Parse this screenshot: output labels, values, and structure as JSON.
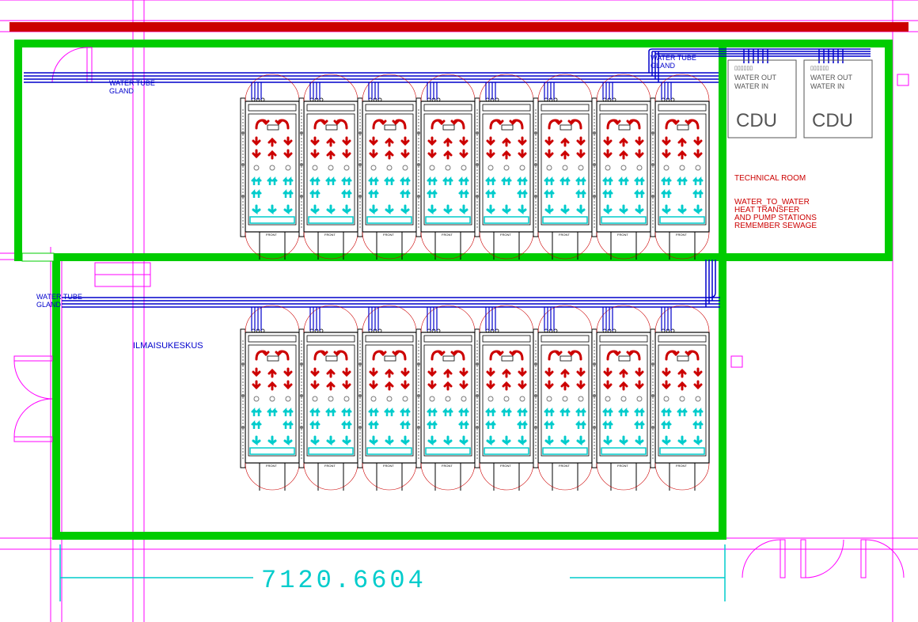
{
  "labels": {
    "water_tube_gland_1": "WATER TUBE",
    "water_tube_gland_2": "GLAND",
    "ilmaisukeskus": "ILMAISUKESKUS",
    "technical_room": "TECHNICAL ROOM",
    "tech_line1": "WATER_TO_WATER",
    "tech_line2": "HEAT TRANSFER",
    "tech_line3": "AND PUMP STATIONS",
    "tech_line4": "REMEMBER SEWAGE",
    "cdu": "CDU",
    "water_out": "WATER OUT",
    "water_in": "WATER IN",
    "dimension": "7120.6604",
    "front": "FRONT"
  },
  "colors": {
    "green_wall": "#00CC00",
    "red_wall": "#CC0000",
    "magenta": "#FF00FF",
    "blue": "#0000CC",
    "cyan": "#00CCCC",
    "black": "#000000",
    "hot": "#CC0000",
    "cold": "#00CCCC",
    "grey": "#777777"
  },
  "layout": {
    "rack_rows": 2,
    "rack_units_per_row": 8,
    "cdu_count": 2
  }
}
